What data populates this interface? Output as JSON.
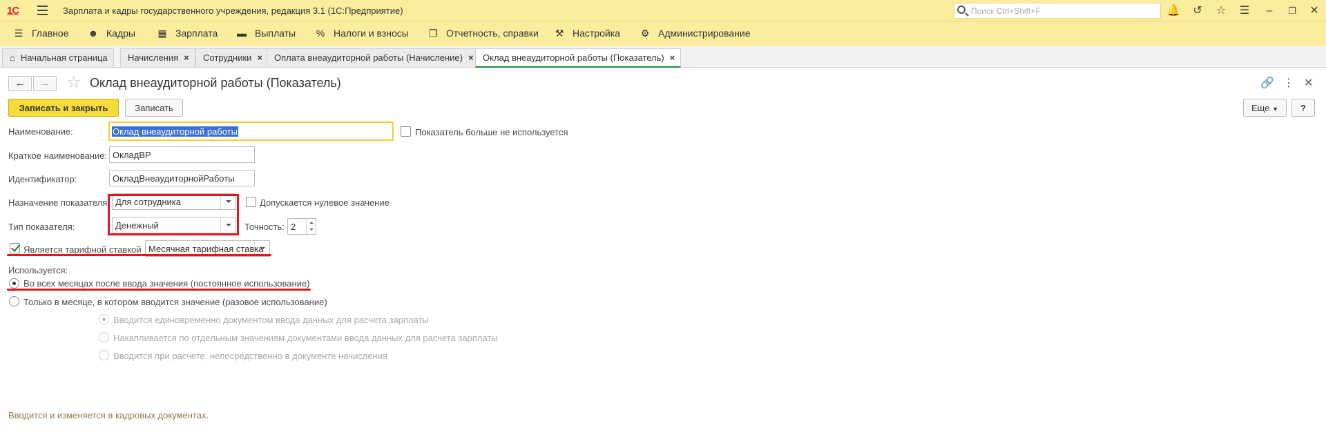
{
  "window": {
    "logo": "1С",
    "title": "Зарплата и кадры государственного учреждения, редакция 3.1  (1С:Предприятие)",
    "search_placeholder": "Поиск Ctrl+Shift+F"
  },
  "main_menu": [
    {
      "label": "Главное",
      "icon": "hamburger-icon"
    },
    {
      "label": "Кадры",
      "icon": "people-icon"
    },
    {
      "label": "Зарплата",
      "icon": "calculator-icon"
    },
    {
      "label": "Выплаты",
      "icon": "wallet-icon"
    },
    {
      "label": "Налоги и взносы",
      "icon": "percent-icon"
    },
    {
      "label": "Отчетность, справки",
      "icon": "report-icon"
    },
    {
      "label": "Настройка",
      "icon": "wrench-icon"
    },
    {
      "label": "Администрирование",
      "icon": "gear-icon"
    }
  ],
  "tabs": [
    {
      "label": "Начальная страница",
      "active": false
    },
    {
      "label": "Начисления",
      "active": false
    },
    {
      "label": "Сотрудники",
      "active": false
    },
    {
      "label": "Оплата внеаудиторной работы (Начисление)",
      "active": false
    },
    {
      "label": "Оклад внеаудиторной работы (Показатель)",
      "active": true
    }
  ],
  "form": {
    "title": "Оклад внеаудиторной работы (Показатель)",
    "buttons": {
      "save_close": "Записать и закрыть",
      "save": "Записать",
      "more": "Еще",
      "help": "?"
    },
    "fields": {
      "name_label": "Наименование:",
      "name_value": "Оклад внеаудиторной работы",
      "not_used_label": "Показатель больше не используется",
      "short_name_label": "Краткое наименование:",
      "short_name_value": "ОкладВР",
      "id_label": "Идентификатор:",
      "id_value": "ОкладВнеаудиторнойРаботы",
      "purpose_label": "Назначение показателя:",
      "purpose_value": "Для сотрудника",
      "zero_allowed_label": "Допускается нулевое значение",
      "type_label": "Тип показателя:",
      "type_value": "Денежный",
      "precision_label": "Точность:",
      "precision_value": "2",
      "tariff_label": "Является тарифной ставкой",
      "tariff_checked": true,
      "tariff_value": "Месячная тарифная ставка"
    },
    "usage": {
      "label": "Используется:",
      "options": [
        {
          "label": "Во всех месяцах после ввода значения (постоянное использование)",
          "selected": true
        },
        {
          "label": "Только в месяце, в котором вводится значение (разовое использование)",
          "selected": false
        }
      ],
      "sub_options": [
        {
          "label": "Вводится единовременно документом ввода данных для расчета зарплаты",
          "selected": true
        },
        {
          "label": "Накапливается по отдельным значениям документами ввода данных для расчета зарплаты",
          "selected": false
        },
        {
          "label": "Вводится при расчете, непосредственно в документе начисления",
          "selected": false
        }
      ]
    },
    "footer_note": "Вводится и изменяется в кадровых документах."
  },
  "colors": {
    "header_bg": "#fbed9e",
    "primary_button": "#f5dc3a",
    "active_tab_accent": "#1c8a3c",
    "highlight_red": "#e0161e",
    "selection": "#3c6fd2"
  }
}
